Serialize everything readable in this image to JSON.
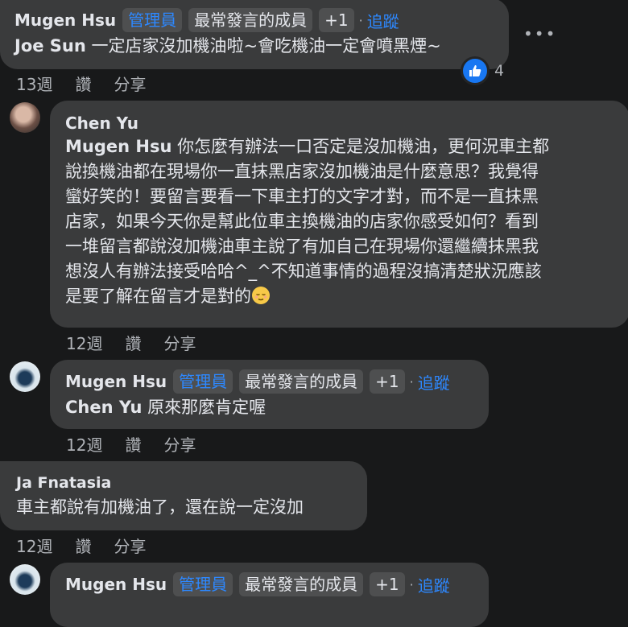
{
  "comments": [
    {
      "author": "Mugen Hsu",
      "badges": [
        "管理員",
        "最常發言的成員",
        "+1"
      ],
      "follow": "追蹤",
      "mention": "Joe Sun",
      "text": " 一定店家沒加機油啦~會吃機油一定會噴黑煙~",
      "time": "13週",
      "like": "讚",
      "share": "分享",
      "reaction_count": "4"
    },
    {
      "author": "Chen Yu",
      "mention": "Mugen Hsu",
      "lines": [
        " 你怎麼有辦法一口否定是沒加機油，更何況車主都",
        "說換機油都在現場你一直抹黑店家沒加機油是什麼意思？我覺得",
        "蠻好笑的！要留言要看一下車主打的文字才對，而不是一直抹黑",
        "店家，如果今天你是幫此位車主換機油的店家你感受如何？看到",
        "一堆留言都說沒加機油車主說了有加自己在現場你還繼續抹黑我",
        "想沒人有辦法接受哈哈^_^不知道事情的過程沒搞清楚狀況應該",
        "是要了解在留言才是對的"
      ],
      "emoji": "relieved-face-emoji",
      "time": "12週",
      "like": "讚",
      "share": "分享"
    },
    {
      "author": "Mugen Hsu",
      "badges": [
        "管理員",
        "最常發言的成員",
        "+1"
      ],
      "follow": "追蹤",
      "mention": "Chen Yu",
      "text": " 原來那麼肯定喔",
      "time": "12週",
      "like": "讚",
      "share": "分享"
    },
    {
      "author": "Ja Fnatasia",
      "text": "車主都說有加機油了，還在說一定沒加",
      "time": "12週",
      "like": "讚",
      "share": "分享"
    },
    {
      "author": "Mugen Hsu",
      "badges": [
        "管理員",
        "最常發言的成員",
        "+1"
      ],
      "follow": "追蹤"
    }
  ],
  "icons": {
    "more": "more-options-icon",
    "like": "thumbs-up-icon"
  },
  "colors": {
    "background": "#18191a",
    "bubble": "#3a3b3c",
    "link": "#2d88ff",
    "muted": "#b0b3b8"
  }
}
